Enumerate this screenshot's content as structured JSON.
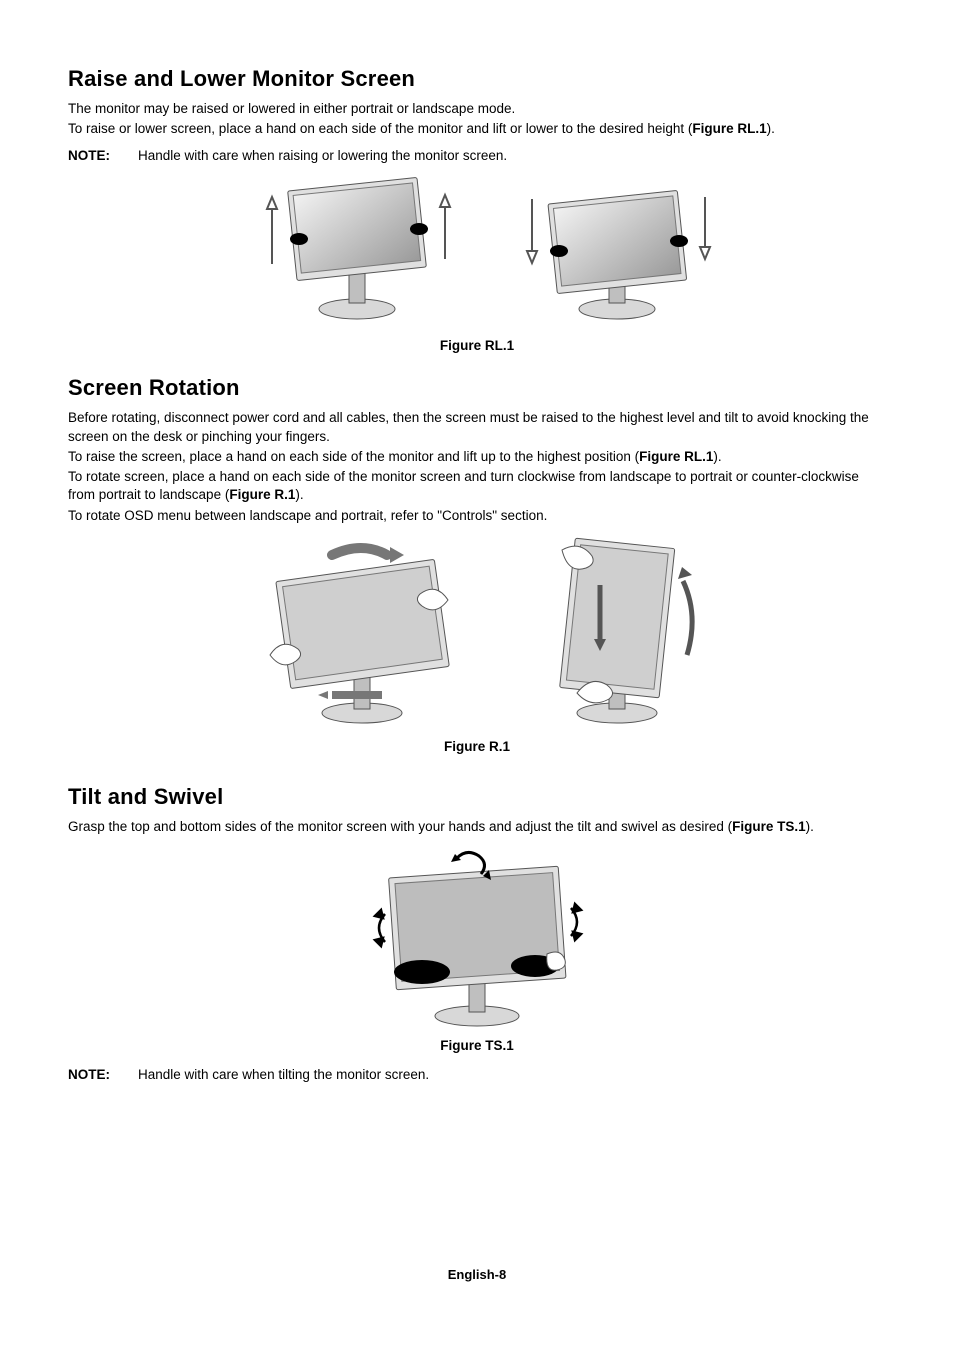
{
  "section1": {
    "heading": "Raise and Lower Monitor Screen",
    "p1": "The monitor may be raised or lowered in either portrait or landscape mode.",
    "p2_pre": "To raise or lower screen, place a hand on each side of the monitor and lift or lower to the desired height (",
    "p2_ref": "Figure RL.1",
    "p2_post": ").",
    "note_label": "NOTE:",
    "note_text": "Handle with care when raising or lowering the monitor screen.",
    "fig_caption": "Figure RL.1"
  },
  "section2": {
    "heading": "Screen Rotation",
    "p1": "Before rotating, disconnect power cord and all cables, then the screen must be raised to the highest level and tilt to avoid knocking the screen on the desk or pinching your fingers.",
    "p2_pre": "To raise the screen, place a hand on each side of the monitor and lift up to the highest position (",
    "p2_ref": "Figure RL.1",
    "p2_post": ").",
    "p3_pre": "To rotate screen, place a hand on each side of the monitor screen and turn clockwise from landscape to portrait or counter-clockwise from portrait to landscape (",
    "p3_ref": "Figure R.1",
    "p3_post": ").",
    "p4": "To rotate OSD menu between landscape and portrait, refer to \"Controls\" section.",
    "fig_caption": "Figure R.1"
  },
  "section3": {
    "heading": "Tilt and Swivel",
    "p1_pre": "Grasp the top and bottom sides of the monitor screen with your hands and adjust the tilt and swivel as desired (",
    "p1_ref": "Figure TS.1",
    "p1_post": ").",
    "fig_caption": "Figure TS.1",
    "note_label": "NOTE:",
    "note_text": "Handle with care when tilting the monitor screen."
  },
  "footer": "English-8"
}
